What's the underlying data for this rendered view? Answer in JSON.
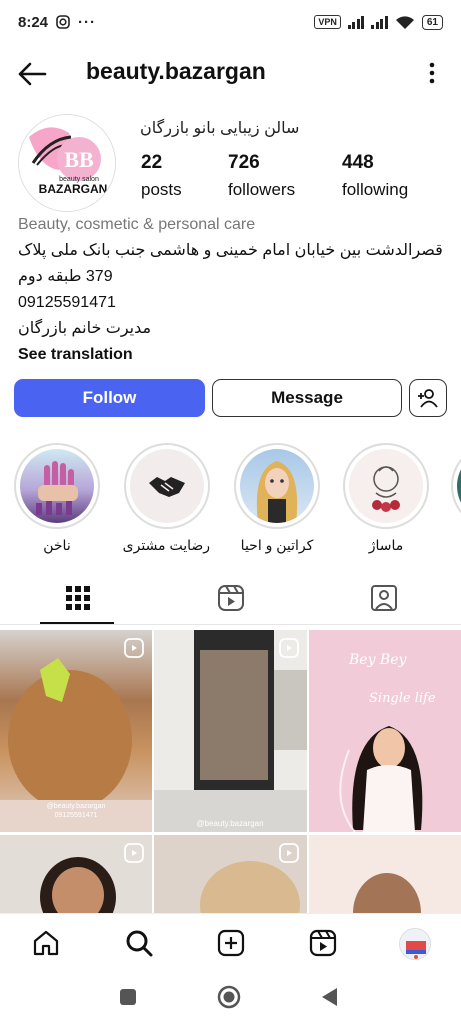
{
  "status_bar": {
    "time": "8:24",
    "vpn": "VPN",
    "battery": "61"
  },
  "header": {
    "username": "beauty.bazargan"
  },
  "profile": {
    "avatar_text_top": "BB",
    "avatar_text_small": "beauty salon",
    "avatar_text_bottom": "BAZARGAN",
    "full_name": "سالن زیبایی بانو بازرگان",
    "stats": [
      {
        "value": "22",
        "label": "posts"
      },
      {
        "value": "726",
        "label": "followers"
      },
      {
        "value": "448",
        "label": "following"
      }
    ],
    "category": "Beauty, cosmetic & personal care",
    "bio_lines": [
      "قصرالدشت بین خیابان امام خمینی و هاشمی جنب بانک ملی پلاک",
      "379 طبقه دوم",
      "09125591471",
      "مدیرت خانم بازرگان"
    ],
    "see_translation": "See translation"
  },
  "actions": {
    "follow": "Follow",
    "message": "Message"
  },
  "highlights": [
    {
      "label": "ناخن",
      "icon": "nails"
    },
    {
      "label": "رضایت مشتری",
      "icon": "handshake"
    },
    {
      "label": "کراتین و احیا",
      "icon": "hair"
    },
    {
      "label": "ماساژ",
      "icon": "spa"
    }
  ],
  "posts": [
    {
      "watermark": "@beauty.bazargan\n09125591471"
    },
    {
      "watermark": "@beauty.bazargan"
    },
    {
      "watermark": "Bey Bey\nSingle life"
    }
  ],
  "colors": {
    "follow_bg": "#4a63f0",
    "accent_pink": "#f6a3c8"
  }
}
